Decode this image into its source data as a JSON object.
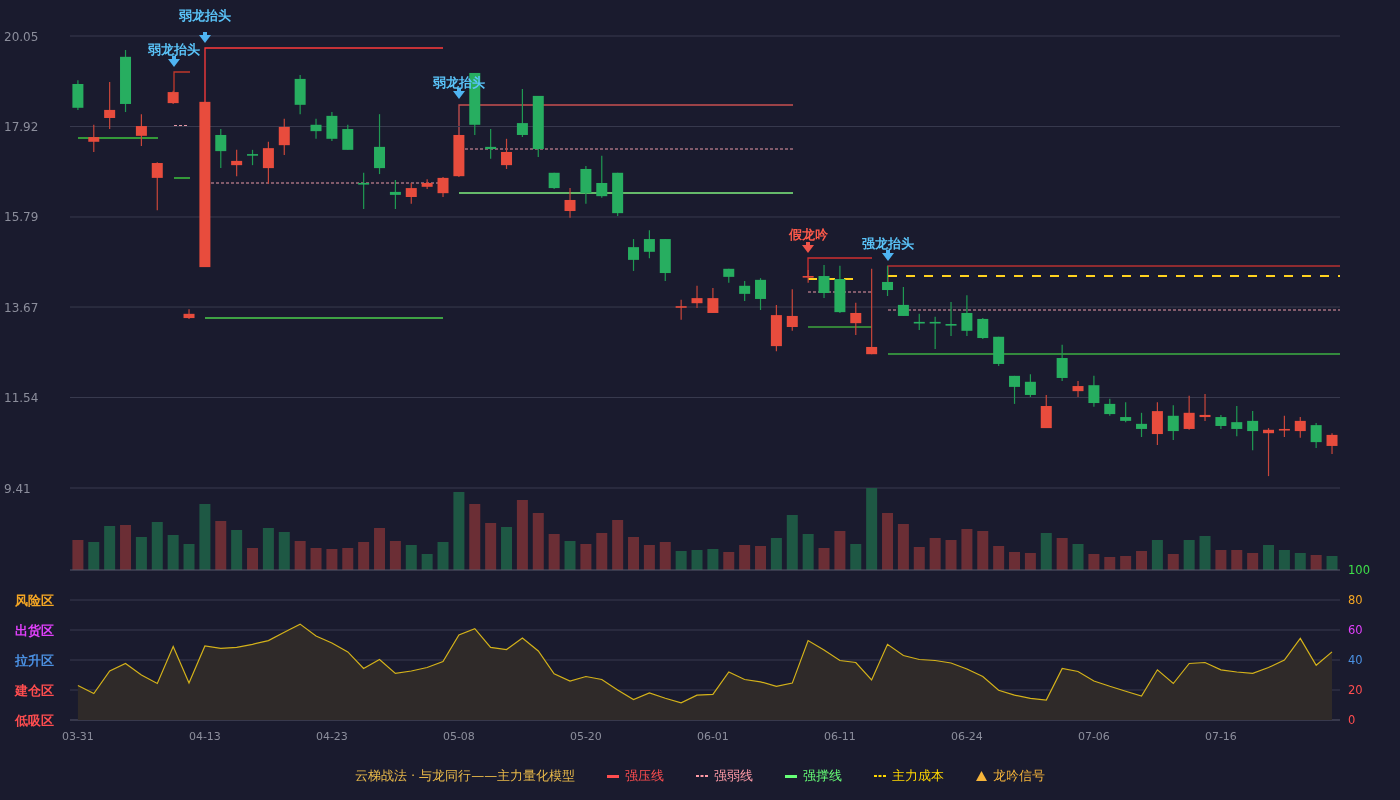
{
  "price_panel": {
    "chart_data": {
      "type": "candlestick",
      "categories": [
        null,
        null,
        null,
        null,
        null,
        null,
        null,
        null,
        null,
        null,
        null,
        null,
        null,
        null,
        null,
        null,
        null,
        null,
        null,
        null,
        null,
        null,
        null,
        null,
        null,
        null,
        null,
        null,
        null,
        null,
        null,
        null,
        null,
        null,
        null,
        null,
        null,
        null,
        null,
        null,
        null,
        null,
        null,
        null,
        null,
        null,
        null,
        null,
        null,
        null,
        null,
        null,
        null,
        null,
        null,
        null,
        null,
        null,
        null,
        null,
        null,
        null,
        null,
        null,
        null,
        null,
        null,
        null,
        null,
        null,
        null,
        null,
        null,
        null,
        null,
        null,
        null,
        null,
        null,
        null
      ],
      "ohlc": [
        [
          18.92,
          19.01,
          18.31,
          18.36
        ],
        [
          17.56,
          17.96,
          17.32,
          17.67
        ],
        [
          18.12,
          18.97,
          17.86,
          18.31
        ],
        [
          19.56,
          19.72,
          18.26,
          18.45
        ],
        [
          17.7,
          18.21,
          17.46,
          17.93
        ],
        [
          16.71,
          17.08,
          15.95,
          17.06
        ],
        [
          18.47,
          18.76,
          18.45,
          18.73
        ],
        [
          13.41,
          13.62,
          13.39,
          13.51
        ],
        [
          14.61,
          18.5,
          14.61,
          18.5
        ],
        [
          17.72,
          17.86,
          16.94,
          17.34
        ],
        [
          17.01,
          17.37,
          16.75,
          17.11
        ],
        [
          17.27,
          17.37,
          17.01,
          17.25
        ],
        [
          16.94,
          17.56,
          16.57,
          17.41
        ],
        [
          17.48,
          18.1,
          17.25,
          17.91
        ],
        [
          19.04,
          19.13,
          18.21,
          18.43
        ],
        [
          17.96,
          18.1,
          17.63,
          17.81
        ],
        [
          18.17,
          18.26,
          17.58,
          17.63
        ],
        [
          17.86,
          17.96,
          17.37,
          17.37
        ],
        [
          16.59,
          16.83,
          15.98,
          16.57
        ],
        [
          17.44,
          18.21,
          16.8,
          16.94
        ],
        [
          16.38,
          16.66,
          15.98,
          16.31
        ],
        [
          16.26,
          16.59,
          16.1,
          16.47
        ],
        [
          16.5,
          16.68,
          16.45,
          16.59
        ],
        [
          16.35,
          16.73,
          16.26,
          16.71
        ],
        [
          16.75,
          17.72,
          16.73,
          17.72
        ],
        [
          19.18,
          19.18,
          17.72,
          17.96
        ],
        [
          17.44,
          17.86,
          17.16,
          17.39
        ],
        [
          17.01,
          17.63,
          16.92,
          17.32
        ],
        [
          18.0,
          18.8,
          17.67,
          17.72
        ],
        [
          18.64,
          18.64,
          17.2,
          17.39
        ],
        [
          16.83,
          16.83,
          16.45,
          16.47
        ],
        [
          15.93,
          16.47,
          15.77,
          16.19
        ],
        [
          16.92,
          16.99,
          16.1,
          16.35
        ],
        [
          16.59,
          17.23,
          16.24,
          16.28
        ],
        [
          16.83,
          16.83,
          15.81,
          15.88
        ],
        [
          15.08,
          15.27,
          14.52,
          14.78
        ],
        [
          15.27,
          15.48,
          14.82,
          14.97
        ],
        [
          15.27,
          15.27,
          14.28,
          14.47
        ],
        [
          13.67,
          13.84,
          13.37,
          13.69
        ],
        [
          13.76,
          14.17,
          13.65,
          13.88
        ],
        [
          13.53,
          14.12,
          13.53,
          13.88
        ],
        [
          14.57,
          14.57,
          14.24,
          14.38
        ],
        [
          14.17,
          14.28,
          13.81,
          13.98
        ],
        [
          14.31,
          14.35,
          13.6,
          13.86
        ],
        [
          12.75,
          13.72,
          12.63,
          13.48
        ],
        [
          13.2,
          14.09,
          13.11,
          13.46
        ],
        [
          14.38,
          14.54,
          14.24,
          14.4
        ],
        [
          14.4,
          14.66,
          13.88,
          14.0
        ],
        [
          14.33,
          14.64,
          13.53,
          13.55
        ],
        [
          13.29,
          13.77,
          13.01,
          13.53
        ],
        [
          12.56,
          14.57,
          12.56,
          12.73
        ],
        [
          14.26,
          14.64,
          13.93,
          14.07
        ],
        [
          13.72,
          14.14,
          13.46,
          13.46
        ],
        [
          13.32,
          13.51,
          13.13,
          13.29
        ],
        [
          13.32,
          13.44,
          12.68,
          13.29
        ],
        [
          13.27,
          13.79,
          12.99,
          13.25
        ],
        [
          13.53,
          13.95,
          12.99,
          13.11
        ],
        [
          13.39,
          13.41,
          12.92,
          12.94
        ],
        [
          12.97,
          12.97,
          12.28,
          12.33
        ],
        [
          12.05,
          12.05,
          11.39,
          11.79
        ],
        [
          11.91,
          12.09,
          11.55,
          11.6
        ],
        [
          10.82,
          11.6,
          10.82,
          11.34
        ],
        [
          12.47,
          12.78,
          11.93,
          12.0
        ],
        [
          11.69,
          11.93,
          11.55,
          11.81
        ],
        [
          11.83,
          12.05,
          11.32,
          11.41
        ],
        [
          11.39,
          11.51,
          11.11,
          11.15
        ],
        [
          11.08,
          11.43,
          10.96,
          10.99
        ],
        [
          10.92,
          11.18,
          10.61,
          10.8
        ],
        [
          10.68,
          11.43,
          10.42,
          11.22
        ],
        [
          11.11,
          11.36,
          10.54,
          10.75
        ],
        [
          10.8,
          11.58,
          10.78,
          11.18
        ],
        [
          11.08,
          11.62,
          10.99,
          11.13
        ],
        [
          11.08,
          11.13,
          10.8,
          10.87
        ],
        [
          10.96,
          11.34,
          10.63,
          10.8
        ],
        [
          10.99,
          11.22,
          10.3,
          10.75
        ],
        [
          10.7,
          10.82,
          9.69,
          10.78
        ],
        [
          10.78,
          11.11,
          10.61,
          10.8
        ],
        [
          10.75,
          11.08,
          10.59,
          10.99
        ],
        [
          10.89,
          10.94,
          10.35,
          10.49
        ],
        [
          10.4,
          10.7,
          10.21,
          10.66
        ]
      ],
      "ylim": [
        9.41,
        20.05
      ],
      "yticks": [
        20.05,
        17.92,
        15.79,
        13.67,
        11.54,
        9.41
      ],
      "grid": true
    },
    "signals": [
      {
        "label": "弱龙抬头",
        "kind": "weak"
      },
      {
        "label": "弱龙抬头",
        "kind": "weak"
      },
      {
        "label": "弱龙抬头",
        "kind": "weak"
      },
      {
        "label": "假龙吟",
        "kind": "fake"
      },
      {
        "label": "强龙抬头",
        "kind": "strong"
      }
    ]
  },
  "indicator_panel": {
    "zones": [
      {
        "label": "风险区",
        "color": "#f5a623"
      },
      {
        "label": "出货区",
        "color": "#e040fb"
      },
      {
        "label": "拉升区",
        "color": "#4a90e2"
      },
      {
        "label": "建仓区",
        "color": "#ff4d4f"
      },
      {
        "label": "低吸区",
        "color": "#ff4d4f"
      }
    ],
    "chart_data": {
      "type": "area",
      "categories": [
        "03-31",
        null,
        null,
        null,
        null,
        null,
        null,
        null,
        "04-13",
        null,
        null,
        null,
        null,
        null,
        null,
        null,
        "04-23",
        null,
        null,
        null,
        null,
        null,
        null,
        null,
        "05-08",
        null,
        null,
        null,
        null,
        null,
        null,
        null,
        "05-20",
        null,
        null,
        null,
        null,
        null,
        null,
        null,
        "06-01",
        null,
        null,
        null,
        null,
        null,
        null,
        null,
        "06-11",
        null,
        null,
        null,
        null,
        null,
        null,
        null,
        "06-24",
        null,
        null,
        null,
        null,
        null,
        null,
        null,
        "07-06",
        null,
        null,
        null,
        null,
        null,
        null,
        null,
        "07-16",
        null,
        null,
        null,
        null,
        null,
        null,
        null
      ],
      "ylim": [
        0,
        100
      ],
      "yticks": [
        0,
        20,
        40,
        60,
        80,
        100
      ],
      "grid": true,
      "values": [
        23,
        17.7,
        32.7,
        37.7,
        30,
        24.3,
        49,
        24.6,
        49.3,
        47.8,
        48.4,
        50.5,
        52.9,
        58.5,
        63.9,
        55.9,
        51.3,
        45.4,
        34.4,
        40.3,
        31.1,
        32.7,
        35,
        38.9,
        56.7,
        60.9,
        48.4,
        46.9,
        54.7,
        46,
        30.8,
        26,
        29,
        27,
        20,
        13.6,
        18,
        14.5,
        11.5,
        16.6,
        17.1,
        32,
        27,
        25.5,
        22.5,
        24.6,
        52.9,
        46.7,
        39.7,
        38.3,
        26.7,
        50.5,
        43,
        40.3,
        39.7,
        38,
        34,
        29,
        19.8,
        16.6,
        14.5,
        13.3,
        34.4,
        32.3,
        26,
        22.5,
        19.2,
        16,
        33.5,
        24.3,
        37.7,
        38.3,
        33.5,
        32,
        31.1,
        35,
        40,
        54.4,
        36.5,
        45.4
      ]
    }
  },
  "legend": {
    "title": "云梯战法 · 与龙同行——主力量化模型",
    "items": [
      {
        "label": "强压线",
        "kind": "solid",
        "color": "#ff4d4f"
      },
      {
        "label": "强弱线",
        "kind": "dashed",
        "color": "#ff9aa6"
      },
      {
        "label": "强撑线",
        "kind": "solid",
        "color": "#66ff77"
      },
      {
        "label": "主力成本",
        "kind": "dashed",
        "color": "#ffd700"
      },
      {
        "label": "龙吟信号",
        "kind": "triangle",
        "color": "#f5b43a"
      }
    ]
  }
}
